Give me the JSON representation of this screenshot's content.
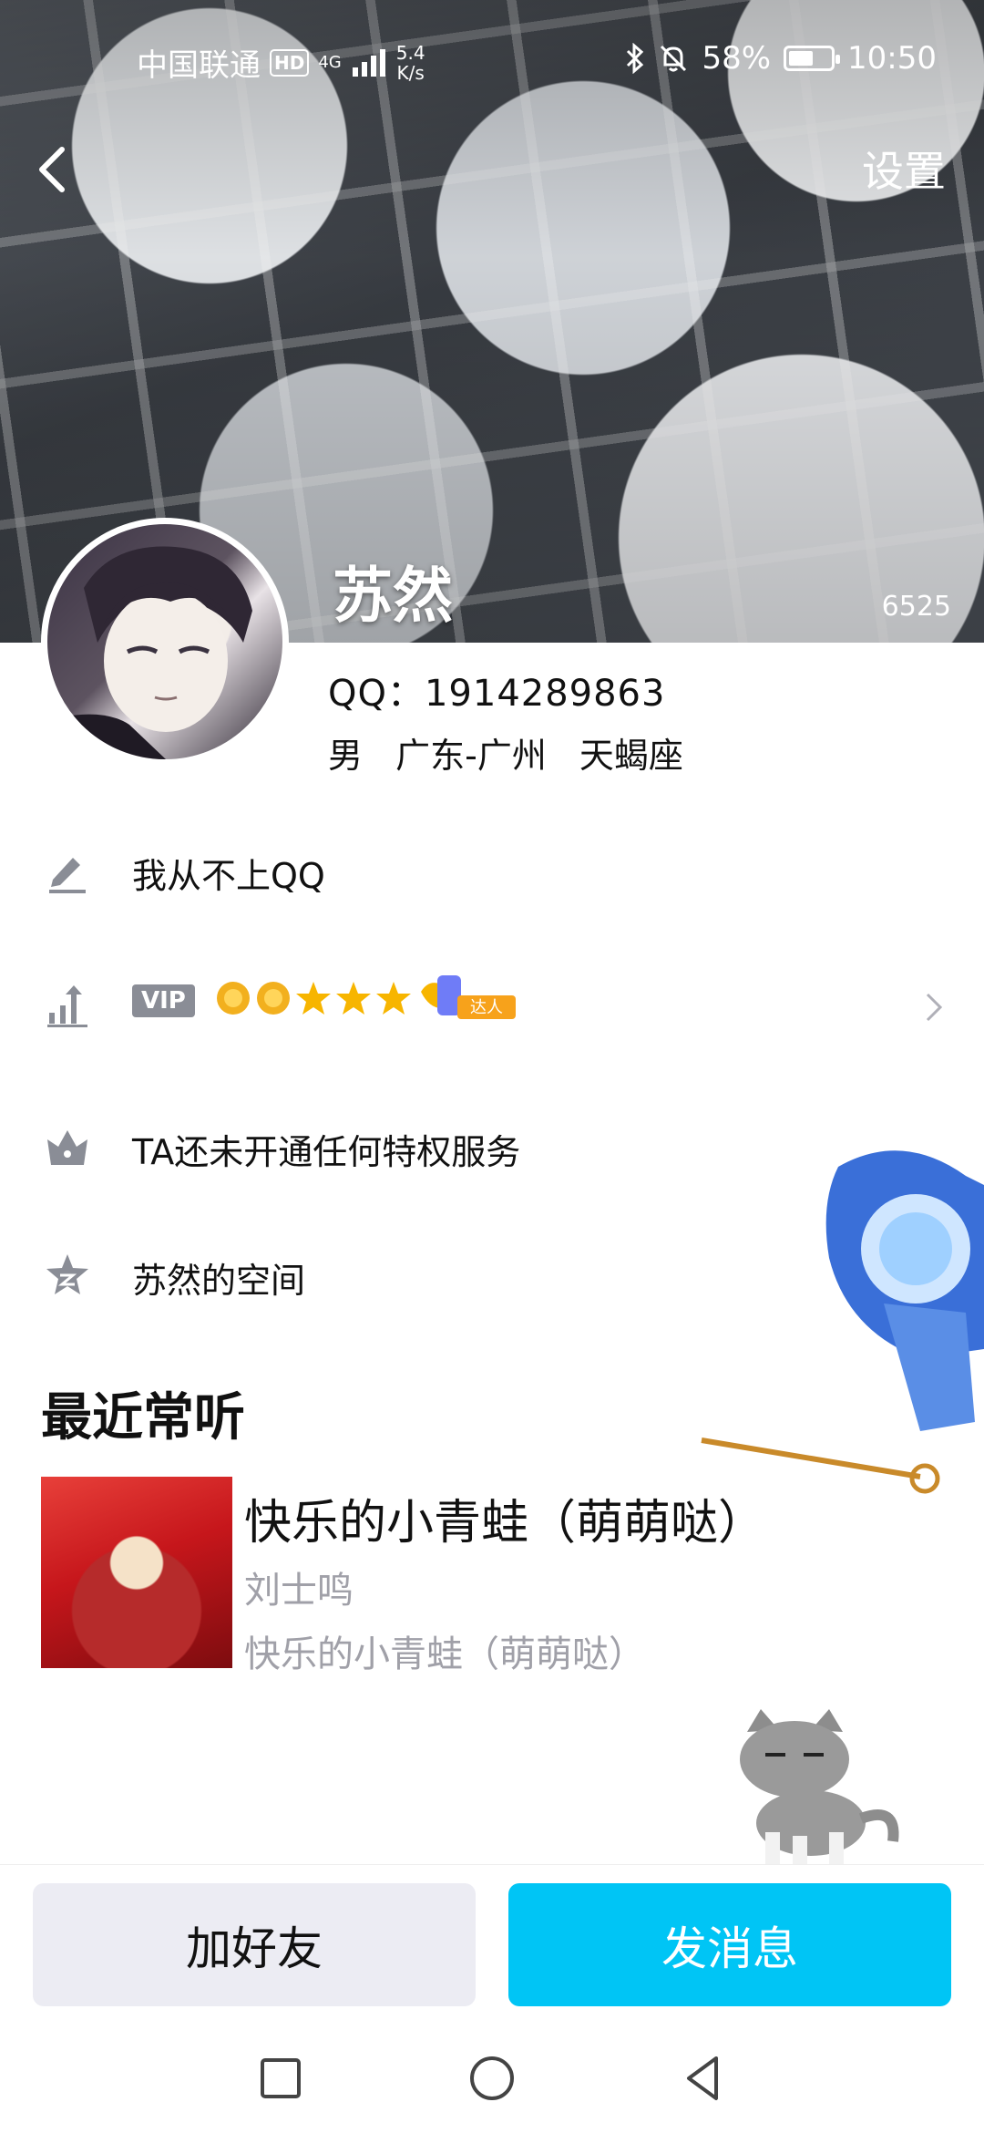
{
  "status_bar": {
    "carrier": "中国联通",
    "hd": "HD",
    "network": "4G",
    "speed_value": "5.4",
    "speed_unit": "K/s",
    "battery_text": "58%",
    "battery_level": 0.58,
    "time": "10:50"
  },
  "header": {
    "settings_label": "设置",
    "username": "苏然",
    "likes_count": "6525"
  },
  "profile": {
    "qq_line": "QQ：1914289863",
    "gender": "男",
    "location": "广东-广州",
    "constellation": "天蝎座"
  },
  "rows": {
    "signature": "我从不上QQ",
    "vip_badge": "VIP",
    "daren_label": "达人",
    "privilege": "TA还未开通任何特权服务",
    "space": "苏然的空间"
  },
  "recent": {
    "title": "最近常听",
    "song_title": "快乐的小青蛙（萌萌哒）",
    "artist": "刘士鸣",
    "album": "快乐的小青蛙（萌萌哒）"
  },
  "actions": {
    "add_friend": "加好友",
    "send_message": "发消息"
  },
  "colors": {
    "accent": "#00c5f5",
    "icon_gray": "#8a8d96",
    "secondary_text": "#a0a0a8"
  }
}
